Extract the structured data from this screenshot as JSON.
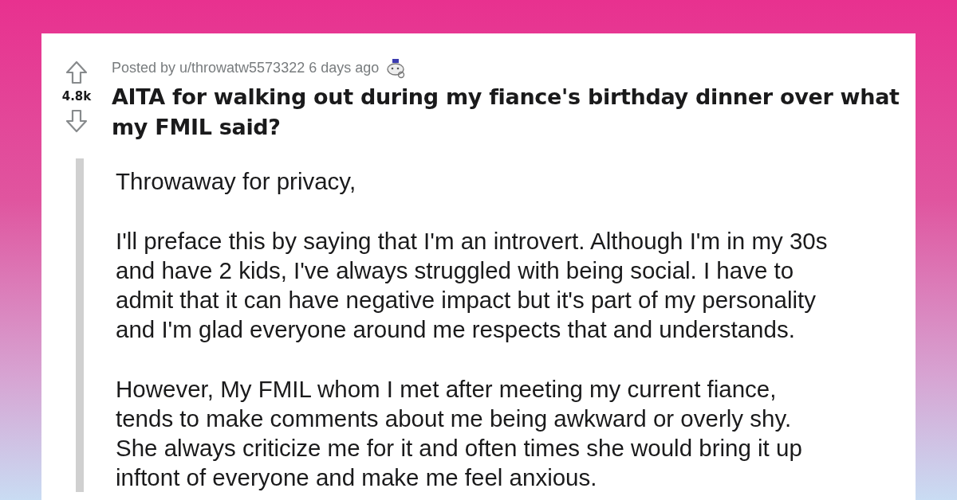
{
  "post": {
    "score": "4.8k",
    "meta": "Posted by u/throwatw5573322 6 days ago",
    "title_lines": [
      "AITA for walking out during my fiance's birthday dinner over what",
      "my FMIL said?"
    ],
    "paragraphs": [
      {
        "lines": [
          "Throwaway for privacy,"
        ]
      },
      {
        "lines": [
          "I'll preface this by saying that I'm an introvert. Although I'm in my 30s",
          "and have 2 kids, I've always struggled with being social. I have to",
          "admit that it can have negative impact but it's part of my personality",
          "and I'm glad everyone around me respects that and understands."
        ]
      },
      {
        "lines": [
          "However, My FMIL whom I met after meeting my current fiance,",
          "tends to make comments about me being awkward or overly shy.",
          "She always criticize me for it and often times she would bring it up",
          "inftont of everyone and make me feel anxious."
        ]
      }
    ]
  }
}
